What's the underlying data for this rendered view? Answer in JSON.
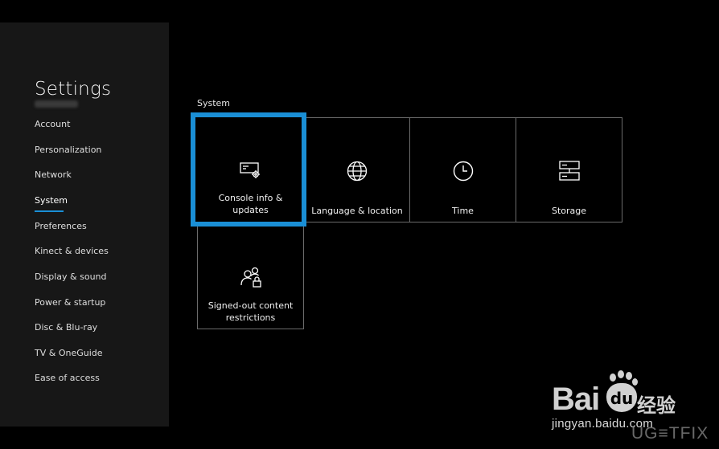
{
  "sidebar": {
    "title": "Settings",
    "items": [
      {
        "label": "Account"
      },
      {
        "label": "Personalization"
      },
      {
        "label": "Network"
      },
      {
        "label": "System"
      },
      {
        "label": "Preferences"
      },
      {
        "label": "Kinect & devices"
      },
      {
        "label": "Display & sound"
      },
      {
        "label": "Power & startup"
      },
      {
        "label": "Disc & Blu-ray"
      },
      {
        "label": "TV & OneGuide"
      },
      {
        "label": "Ease of access"
      }
    ],
    "active_item": "System"
  },
  "main": {
    "section_label": "System",
    "tiles": [
      {
        "label": "Console info & updates",
        "icon": "console-info-icon",
        "focused": true
      },
      {
        "label": "Language & location",
        "icon": "globe-icon"
      },
      {
        "label": "Time",
        "icon": "clock-icon"
      },
      {
        "label": "Storage",
        "icon": "storage-icon"
      },
      {
        "label": "Signed-out content restrictions",
        "icon": "users-lock-icon"
      }
    ]
  },
  "watermarks": {
    "baidu_logo_text": "Bai",
    "baidu_du": "du",
    "baidu_jingyan": "经验",
    "baidu_url": "jingyan.baidu.com",
    "ugetfix": "UG≡TFIX"
  },
  "colors": {
    "accent": "#1a8fd6",
    "sidebar_bg": "#171717",
    "background": "#000000",
    "tile_border": "#6b6b6b"
  }
}
